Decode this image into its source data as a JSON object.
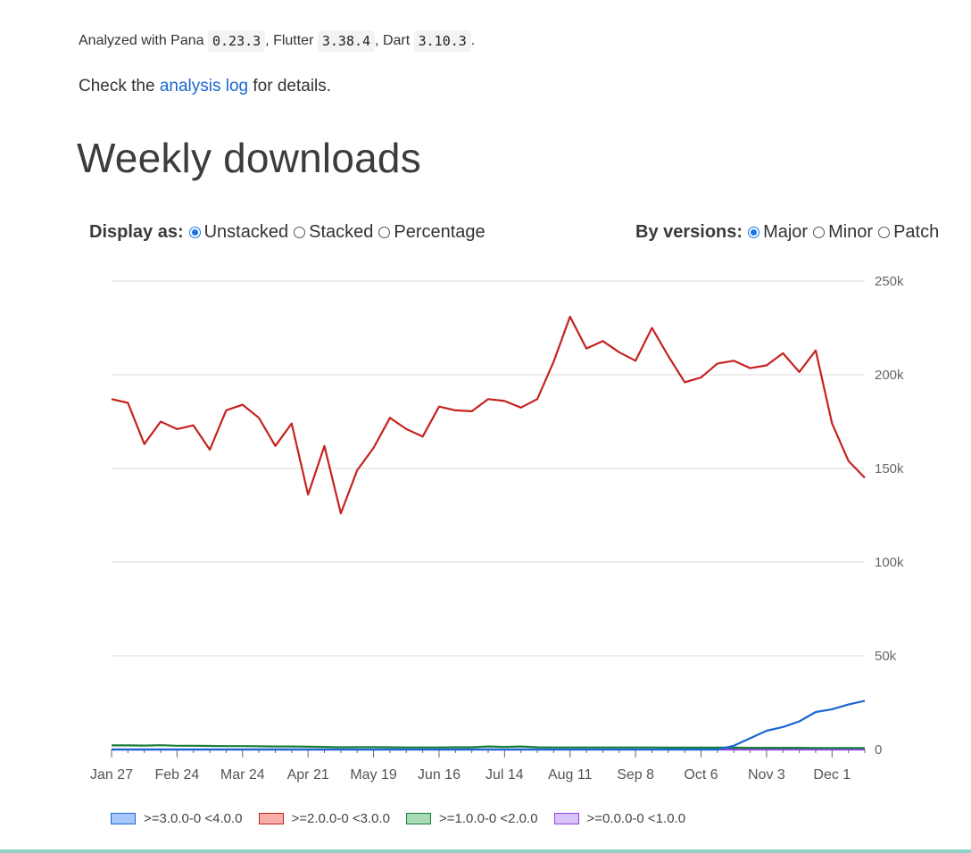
{
  "analysis": {
    "prefix": "Analyzed with Pana ",
    "pana_version": "0.23.3",
    "flutter_label": ", Flutter ",
    "flutter_version": "3.38.4",
    "dart_label": ", Dart ",
    "dart_version": "3.10.3",
    "suffix": ".",
    "check_prefix": "Check the ",
    "log_link": "analysis log",
    "check_suffix": " for details."
  },
  "section_title": "Weekly downloads",
  "display_as": {
    "label": "Display as:",
    "options": [
      {
        "label": "Unstacked",
        "selected": true
      },
      {
        "label": "Stacked",
        "selected": false
      },
      {
        "label": "Percentage",
        "selected": false
      }
    ]
  },
  "by_versions": {
    "label": "By versions:",
    "options": [
      {
        "label": "Major",
        "selected": true
      },
      {
        "label": "Minor",
        "selected": false
      },
      {
        "label": "Patch",
        "selected": false
      }
    ]
  },
  "chart_data": {
    "type": "line",
    "x_tick_labels": [
      "Jan 27",
      "Feb 24",
      "Mar 24",
      "Apr 21",
      "May 19",
      "Jun 16",
      "Jul 14",
      "Aug 11",
      "Sep 8",
      "Oct 6",
      "Nov 3",
      "Dec 1"
    ],
    "y_tick_labels": [
      "250k",
      "200k",
      "150k",
      "100k",
      "50k",
      "0"
    ],
    "ylim": [
      0,
      250000
    ],
    "weeks": 47,
    "grid": true,
    "legend": "bottom",
    "series": [
      {
        "name": ">=3.0.0-0 <4.0.0",
        "color": "#1967d2",
        "fill": "#a8c7fa",
        "values": [
          0,
          0,
          0,
          0,
          0,
          0,
          0,
          0,
          0,
          0,
          0,
          0,
          0,
          0,
          0,
          0,
          0,
          0,
          0,
          0,
          0,
          0,
          0,
          0,
          0,
          0,
          0,
          0,
          0,
          0,
          0,
          0,
          0,
          0,
          0,
          0,
          0,
          0,
          2000,
          6000,
          10000,
          12000,
          15000,
          20000,
          21500,
          24000,
          26000
        ]
      },
      {
        "name": ">=2.0.0-0 <3.0.0",
        "color": "#c5221f",
        "fill": "#f6aea9",
        "values": [
          187000,
          185000,
          163000,
          175000,
          171000,
          173000,
          160000,
          181000,
          184000,
          177000,
          162000,
          174000,
          136000,
          162000,
          126000,
          149000,
          161000,
          177000,
          171000,
          167000,
          183000,
          181000,
          180500,
          187000,
          186000,
          182500,
          187000,
          207000,
          231000,
          214000,
          218000,
          212000,
          207500,
          225000,
          210000,
          196000,
          198500,
          206000,
          207500,
          203500,
          205000,
          211500,
          201500,
          213000,
          174000,
          154000,
          145000
        ]
      },
      {
        "name": ">=1.0.0-0 <2.0.0",
        "color": "#188038",
        "fill": "#a8dab5",
        "values": [
          2200,
          2200,
          2100,
          2300,
          2000,
          2000,
          1900,
          1800,
          1800,
          1700,
          1600,
          1600,
          1500,
          1400,
          1200,
          1300,
          1300,
          1200,
          1100,
          1100,
          1100,
          1200,
          1200,
          1600,
          1400,
          1600,
          1200,
          1100,
          1100,
          1100,
          1100,
          1100,
          1100,
          1100,
          1000,
          1000,
          1000,
          1000,
          1000,
          900,
          900,
          900,
          900,
          800,
          800,
          800,
          800
        ]
      },
      {
        "name": ">=0.0.0-0 <1.0.0",
        "color": "#8e44e8",
        "fill": "#d7c3f7",
        "values": [
          0,
          0,
          0,
          0,
          0,
          0,
          0,
          0,
          0,
          0,
          0,
          0,
          0,
          0,
          0,
          0,
          0,
          0,
          0,
          0,
          0,
          0,
          0,
          0,
          0,
          0,
          0,
          0,
          0,
          0,
          0,
          0,
          0,
          0,
          0,
          0,
          0,
          0,
          0,
          0,
          0,
          0,
          0,
          0,
          0,
          0,
          0
        ]
      }
    ]
  }
}
